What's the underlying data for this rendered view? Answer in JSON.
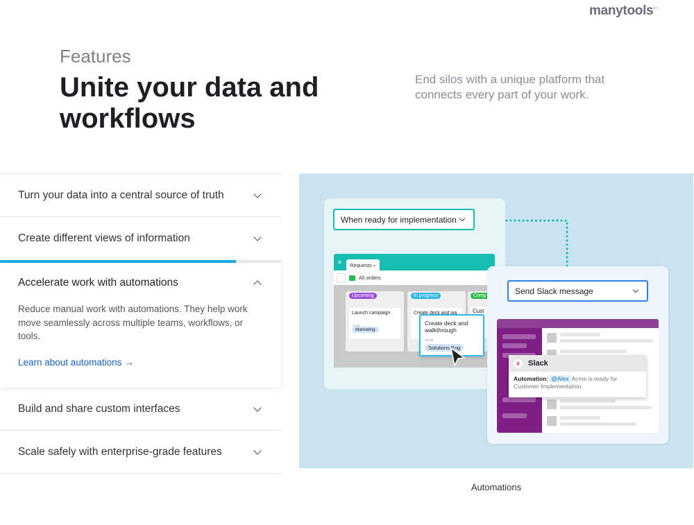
{
  "logo": {
    "text": "manytools",
    "tm": "tm"
  },
  "hero": {
    "eyebrow": "Features",
    "title": "Unite your data and workflows",
    "subtitle": "End silos with a unique platform that connects every part of your work."
  },
  "accordion": {
    "items": [
      {
        "label": "Turn your data into a central source of truth"
      },
      {
        "label": "Create different views of information"
      },
      {
        "label": "Accelerate work with automations",
        "expanded": true,
        "progress_percent": 84,
        "body": "Reduce manual work with automations. They help work move seamlessly across multiple teams, workflows, or tools.",
        "link": "Learn about automations"
      },
      {
        "label": "Build and share custom interfaces"
      },
      {
        "label": "Scale safely with enterprise-grade features"
      }
    ]
  },
  "illustration": {
    "trigger": "When ready for implementation",
    "action": "Send Slack message",
    "kanban": {
      "tab": "Requests",
      "view": "All orders",
      "columns": [
        {
          "label": "Upcoming",
          "color": "#9b4fe0"
        },
        {
          "label": "In progress",
          "color": "#2fb6e8"
        },
        {
          "label": "Comp",
          "color": "#2dbd4e"
        }
      ],
      "cards": [
        {
          "title": "Launch campaign",
          "team_label": "TEAM",
          "team": "Marketing"
        },
        {
          "title": "Create deck and wa",
          "team_label": "TEAM"
        },
        {
          "title": "Cust"
        }
      ],
      "drag_card": {
        "title": "Create deck and walkthrough",
        "team_label": "TEAM",
        "team": "Solutions Eng"
      }
    },
    "slack": {
      "title": "Slack",
      "prefix": "Automation:",
      "mention": "@Alex",
      "message": "Acme is ready for Customer Implementation."
    },
    "caption": "Automations"
  },
  "colors": {
    "accent": "#1ea7e1",
    "link": "#1660c9",
    "teal": "#17bdb1",
    "slack_purple": "#7f1f86"
  }
}
